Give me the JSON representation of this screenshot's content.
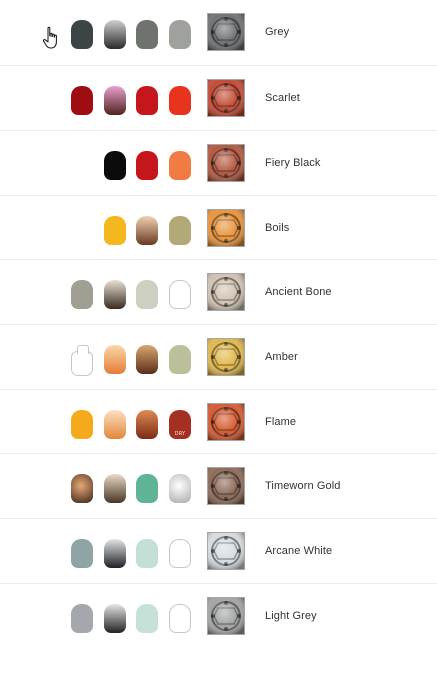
{
  "rows": [
    {
      "name": "Grey",
      "swatch": "#6e7272",
      "pots": [
        {
          "slot": 0,
          "color": "#3c4446"
        },
        {
          "slot": 1,
          "grad": [
            "#cfcfcf",
            "#2a2a2a"
          ]
        },
        {
          "slot": 2,
          "color": "#6f736e"
        },
        {
          "slot": 3,
          "color": "#9ea19c"
        }
      ]
    },
    {
      "name": "Scarlet",
      "swatch": "#c34a34",
      "pots": [
        {
          "slot": 0,
          "color": "#9f0c12"
        },
        {
          "slot": 1,
          "grad": [
            "#e8a0d0",
            "#51231c"
          ]
        },
        {
          "slot": 2,
          "color": "#c5161b"
        },
        {
          "slot": 3,
          "color": "#e8331f"
        }
      ]
    },
    {
      "name": "Fiery Black",
      "swatch": "#b3583f",
      "pots": [
        {
          "slot": 1,
          "color": "#0a0a0a"
        },
        {
          "slot": 2,
          "color": "#c5161b"
        },
        {
          "slot": 3,
          "color": "#f07c44"
        }
      ]
    },
    {
      "name": "Boils",
      "swatch": "#e9943b",
      "pots": [
        {
          "slot": 1,
          "color": "#f4b81f"
        },
        {
          "slot": 2,
          "grad": [
            "#f2d2b2",
            "#6a3a24"
          ]
        },
        {
          "slot": 3,
          "color": "#b2a878"
        }
      ]
    },
    {
      "name": "Ancient Bone",
      "swatch": "#d1c3b3",
      "pots": [
        {
          "slot": 0,
          "color": "#a19f94"
        },
        {
          "slot": 1,
          "grad": [
            "#e8e1d6",
            "#3a2a20"
          ]
        },
        {
          "slot": 2,
          "color": "#cdd0c0"
        },
        {
          "slot": 3,
          "outline": true
        }
      ]
    },
    {
      "name": "Amber",
      "swatch": "#e2b84c",
      "pots": [
        {
          "slot": 0,
          "glass": true
        },
        {
          "slot": 1,
          "grad": [
            "#f8d8a8",
            "#e57c36"
          ]
        },
        {
          "slot": 2,
          "grad": [
            "#d9a870",
            "#5a2e18"
          ]
        },
        {
          "slot": 3,
          "color": "#bcc09a"
        }
      ]
    },
    {
      "name": "Flame",
      "swatch": "#d65a30",
      "pots": [
        {
          "slot": 0,
          "color": "#f5aa1c"
        },
        {
          "slot": 1,
          "grad": [
            "#fae0c4",
            "#e4873a"
          ]
        },
        {
          "slot": 2,
          "grad": [
            "#e08a54",
            "#7a2a14"
          ]
        },
        {
          "slot": 3,
          "color": "#a52f22",
          "tag": "DRY"
        }
      ]
    },
    {
      "name": "Timeworn Gold",
      "swatch": "#8c6a58",
      "pots": [
        {
          "slot": 0,
          "radial": [
            "#e6a878",
            "#3a2216"
          ]
        },
        {
          "slot": 1,
          "grad": [
            "#e9d9c6",
            "#4a3626"
          ]
        },
        {
          "slot": 2,
          "color": "#5fb496"
        },
        {
          "slot": 3,
          "radial": [
            "#ffffff",
            "#a8a8a8"
          ]
        }
      ]
    },
    {
      "name": "Arcane White",
      "swatch": "#d6dce0",
      "pots": [
        {
          "slot": 0,
          "color": "#8fa4a4"
        },
        {
          "slot": 1,
          "grad": [
            "#e2e6ea",
            "#1f2124"
          ]
        },
        {
          "slot": 2,
          "color": "#c4e0d6"
        },
        {
          "slot": 3,
          "outline": true
        }
      ]
    },
    {
      "name": "Light Grey",
      "swatch": "#a3a5a5",
      "pots": [
        {
          "slot": 0,
          "color": "#a4a7ab"
        },
        {
          "slot": 1,
          "grad": [
            "#e6e6e6",
            "#222222"
          ]
        },
        {
          "slot": 2,
          "color": "#c6e2d8"
        },
        {
          "slot": 3,
          "outline": true
        }
      ]
    }
  ]
}
